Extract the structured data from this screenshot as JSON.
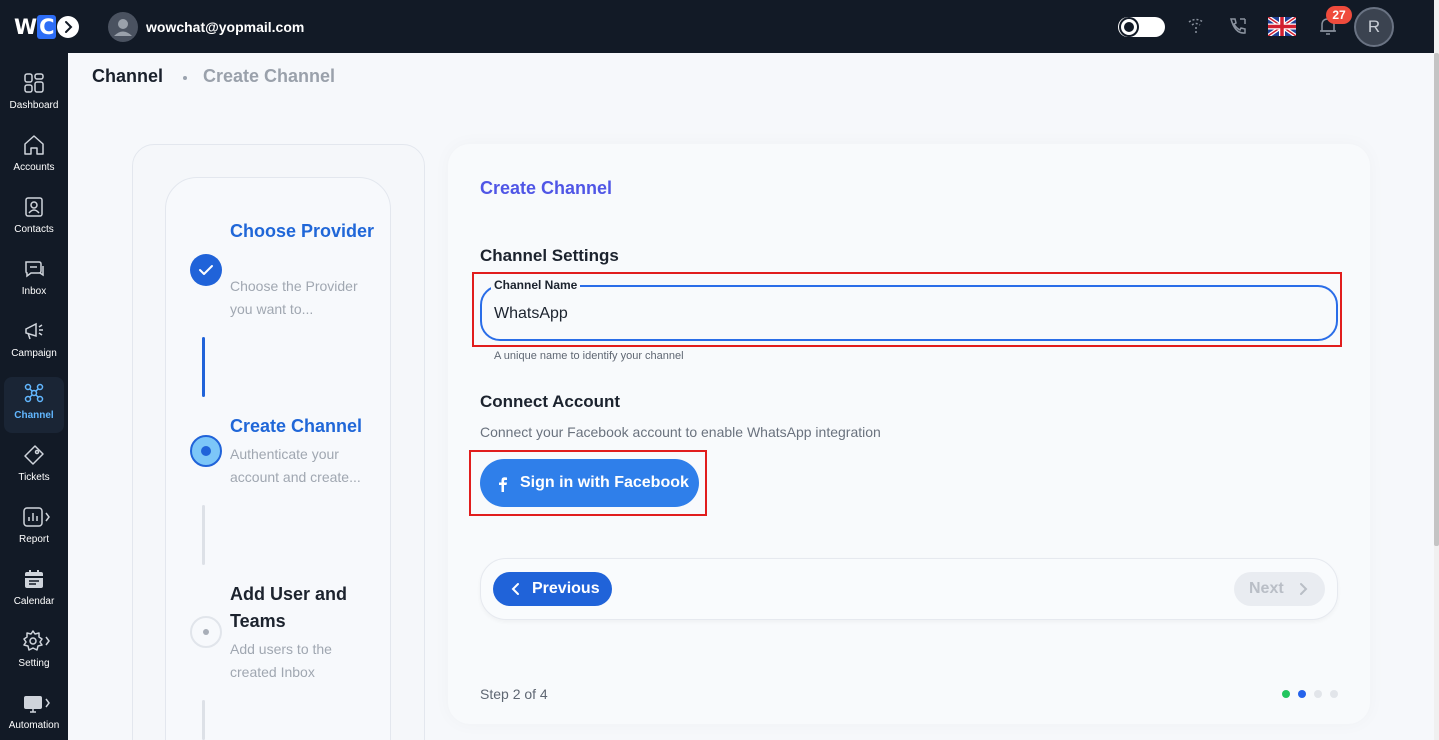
{
  "topbar": {
    "logo_w": "W",
    "logo_c": "C",
    "user_email": "wowchat@yopmail.com",
    "notification_count": "27",
    "profile_initial": "R"
  },
  "sidebar": {
    "items": [
      {
        "label": "Dashboard",
        "icon": "dashboard-icon"
      },
      {
        "label": "Accounts",
        "icon": "home-icon"
      },
      {
        "label": "Contacts",
        "icon": "contacts-icon"
      },
      {
        "label": "Inbox",
        "icon": "chat-icon"
      },
      {
        "label": "Campaign",
        "icon": "megaphone-icon"
      },
      {
        "label": "Channel",
        "icon": "channel-icon",
        "active": true
      },
      {
        "label": "Tickets",
        "icon": "ticket-icon"
      },
      {
        "label": "Report",
        "icon": "chart-icon"
      },
      {
        "label": "Calendar",
        "icon": "calendar-icon"
      },
      {
        "label": "Setting",
        "icon": "gear-icon"
      },
      {
        "label": "Automation",
        "icon": "automation-icon"
      }
    ]
  },
  "breadcrumb": {
    "parent": "Channel",
    "current": "Create Channel"
  },
  "stepper": {
    "steps": [
      {
        "title": "Choose Provider",
        "description": "Choose the Provider you want to...",
        "state": "completed"
      },
      {
        "title": "Create Channel",
        "description": "Authenticate your account and create...",
        "state": "active"
      },
      {
        "title": "Add User and Teams",
        "description": "Add users to the created Inbox",
        "state": "pending"
      }
    ]
  },
  "form": {
    "title": "Create Channel",
    "settings_title": "Channel Settings",
    "channel_name_label": "Channel Name",
    "channel_name_value": "WhatsApp",
    "channel_name_helper": "A unique name to identify your channel",
    "connect_title": "Connect Account",
    "connect_description": "Connect your Facebook account to enable WhatsApp integration",
    "facebook_button": "Sign in with Facebook",
    "previous_button": "Previous",
    "next_button": "Next",
    "step_counter": "Step 2 of 4"
  },
  "colors": {
    "accent": "#2063d9",
    "title_gradient": "#5056e6",
    "highlight": "#e11d1d",
    "dot_done": "#22c55e",
    "dot_active": "#2563eb",
    "dot_pending": "#d1d5db"
  }
}
